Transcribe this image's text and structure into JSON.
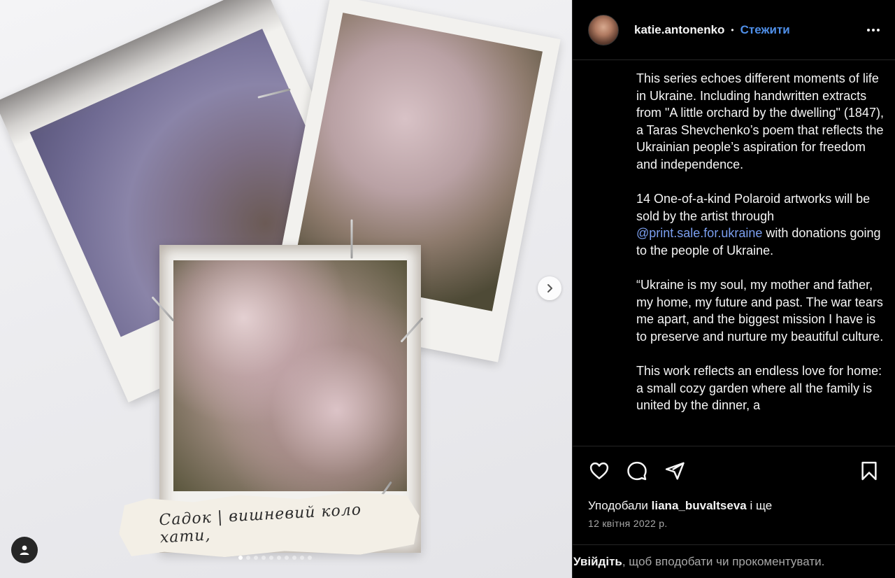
{
  "post": {
    "username": "katie.antonenko",
    "separator": "•",
    "follow_label": "Стежити",
    "caption_paragraphs": [
      "This series echoes different moments of life in Ukraine. Including handwritten extracts from \"A little orchard by the dwelling\" (1847), a Taras Shevchenko’s poem that reflects the Ukrainian people’s aspiration for freedom and independence.",
      "“Ukraine is my soul, my mother and father, my home, my future and past. The war tears me apart, and the biggest mission I have is to preserve and nurture my beautiful culture.",
      "This work reflects an endless love for home: a small cozy garden where all the family is united by the dinner, a"
    ],
    "sale_paragraph": {
      "before": "14 One-of-a-kind Polaroid artworks will be sold by the artist through ",
      "mention": "@print.sale.for.ukraine",
      "after": " with donations going to the people of Ukraine."
    },
    "likes": {
      "prefix": "Уподобали",
      "user": "liana_buvaltseva",
      "suffix": "і ще"
    },
    "date": "12 квітня 2022 р.",
    "login_prompt": {
      "link": "Увійдіть",
      "text": ", щоб вподобати чи прокоментувати."
    }
  },
  "media": {
    "handwriting": "Садок | вишневий коло хати,",
    "carousel": {
      "total": 10,
      "active_index": 0
    }
  },
  "icons": {
    "like": "heart-icon",
    "comment": "comment-icon",
    "share": "share-icon",
    "save": "bookmark-icon",
    "next": "chevron-right-icon",
    "tags": "user-tag-icon",
    "more": "more-options-icon"
  },
  "colors": {
    "link": "#4f8fe8",
    "mention": "#7b9ff0",
    "background": "#000000",
    "text": "#f5f5f5",
    "muted": "#a8a8a8"
  }
}
